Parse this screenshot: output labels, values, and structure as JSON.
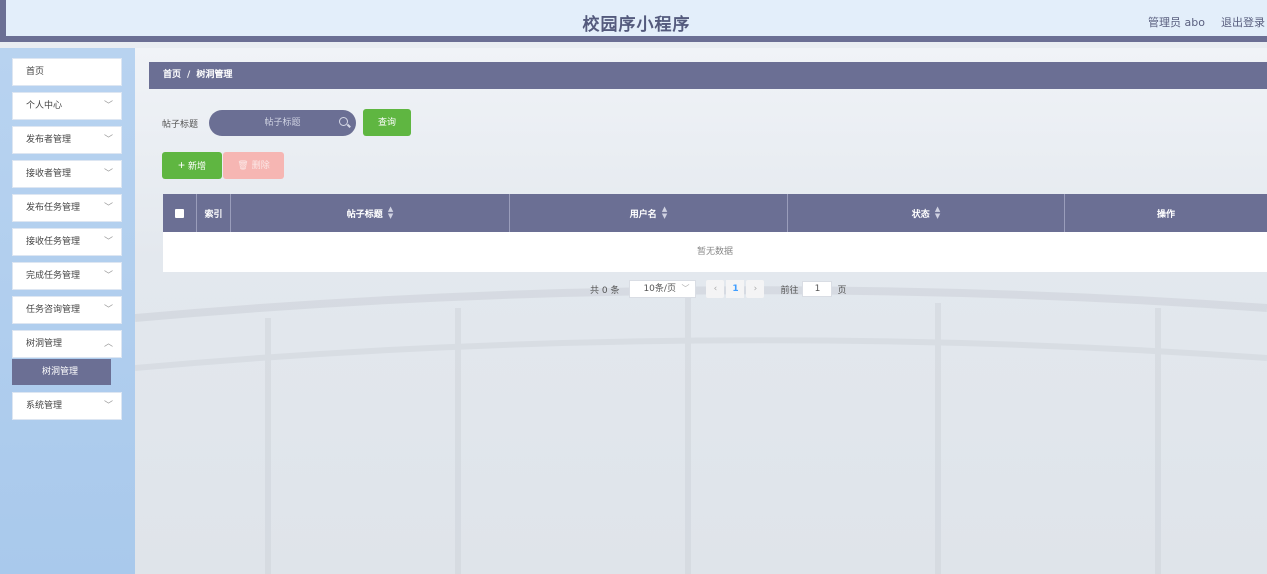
{
  "header": {
    "title": "校园序小程序",
    "user_label": "管理员 abo",
    "logout_label": "退出登录"
  },
  "sidebar": {
    "items": [
      {
        "label": "首页",
        "has_children": false
      },
      {
        "label": "个人中心",
        "has_children": true
      },
      {
        "label": "发布者管理",
        "has_children": true
      },
      {
        "label": "接收者管理",
        "has_children": true
      },
      {
        "label": "发布任务管理",
        "has_children": true
      },
      {
        "label": "接收任务管理",
        "has_children": true
      },
      {
        "label": "完成任务管理",
        "has_children": true
      },
      {
        "label": "任务咨询管理",
        "has_children": true
      },
      {
        "label": "树洞管理",
        "has_children": true
      },
      {
        "label": "系统管理",
        "has_children": true
      }
    ],
    "active_submenu": "树洞管理"
  },
  "breadcrumb": {
    "home": "首页",
    "separator": "/",
    "current": "树洞管理"
  },
  "search": {
    "label": "帖子标题",
    "placeholder": "帖子标题",
    "query_button": "查询"
  },
  "actions": {
    "add_label": "新增",
    "delete_label": "删除"
  },
  "table": {
    "columns": [
      "索引",
      "帖子标题",
      "用户名",
      "状态",
      "操作"
    ],
    "empty_text": "暂无数据"
  },
  "pagination": {
    "total_text": "共 0 条",
    "page_size": "10条/页",
    "current_page": "1",
    "goto_label": "前往",
    "goto_value": "1",
    "page_suffix": "页"
  },
  "colors": {
    "primary": "#6b6f94",
    "success": "#5fb641",
    "danger_light": "#f6b6b3",
    "sidebar_bg": "#b8d3f0"
  }
}
